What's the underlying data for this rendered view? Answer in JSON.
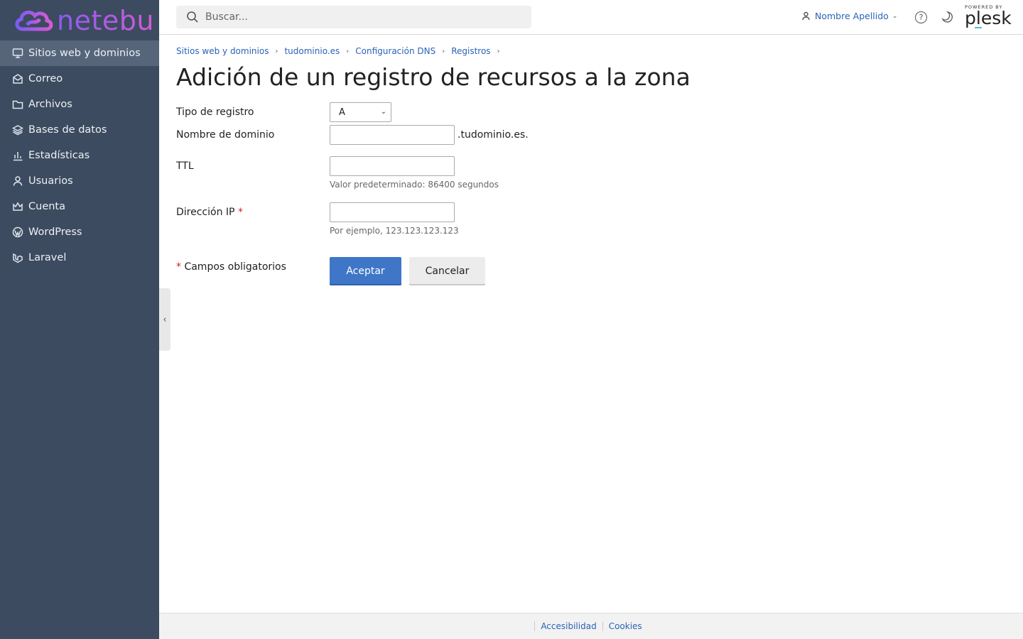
{
  "brand": {
    "name": "netebu",
    "logo_icon": "cloud-icon"
  },
  "sidebar": {
    "items": [
      {
        "label": "Sitios web y dominios",
        "icon": "monitor-icon",
        "active": true
      },
      {
        "label": "Correo",
        "icon": "mail-icon"
      },
      {
        "label": "Archivos",
        "icon": "folder-icon"
      },
      {
        "label": "Bases de datos",
        "icon": "layers-icon"
      },
      {
        "label": "Estadísticas",
        "icon": "bar-chart-icon"
      },
      {
        "label": "Usuarios",
        "icon": "user-icon"
      },
      {
        "label": "Cuenta",
        "icon": "crown-icon"
      },
      {
        "label": "WordPress",
        "icon": "wordpress-icon"
      },
      {
        "label": "Laravel",
        "icon": "laravel-icon"
      }
    ]
  },
  "header": {
    "search_placeholder": "Buscar...",
    "user_name": "Nombre Apellido",
    "help": "?",
    "powered_by": "POWERED BY",
    "plesk": "plesk"
  },
  "breadcrumb": [
    "Sitios web y dominios",
    "tudominio.es",
    "Configuración DNS",
    "Registros"
  ],
  "page_title": "Adición de un registro de recursos a la zona",
  "form": {
    "record_type_label": "Tipo de registro",
    "record_type_value": "A",
    "domain_name_label": "Nombre de dominio",
    "domain_name_value": "",
    "domain_suffix": ".tudominio.es.",
    "ttl_label": "TTL",
    "ttl_value": "",
    "ttl_hint": "Valor predeterminado: 86400 segundos",
    "ip_label": "Dirección IP",
    "ip_value": "",
    "ip_hint": "Por ejemplo, 123.123.123.123",
    "required_mark": "*",
    "required_note": "Campos obligatorios",
    "ok_button": "Aceptar",
    "cancel_button": "Cancelar"
  },
  "footer": {
    "accessibility": "Accesibilidad",
    "cookies": "Cookies"
  },
  "colors": {
    "sidebar_bg": "#3c4b5f",
    "accent": "#3f76c8",
    "link": "#2a63b7",
    "required": "#d02424"
  }
}
